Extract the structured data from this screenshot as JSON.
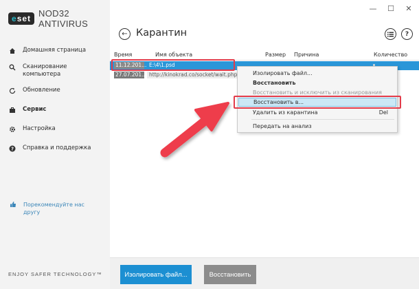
{
  "app": {
    "logo_text": "eset",
    "product_name": "NOD32 ANTIVIRUS",
    "tagline": "ENJOY SAFER TECHNOLOGY™",
    "controls": {
      "minimize": "—",
      "maximize": "☐",
      "close": "✕"
    }
  },
  "sidebar": {
    "items": [
      {
        "label": "Домашняя страница",
        "icon": "home-icon"
      },
      {
        "label": "Сканирование компьютера",
        "icon": "search-icon"
      },
      {
        "label": "Обновление",
        "icon": "refresh-icon"
      },
      {
        "label": "Сервис",
        "icon": "briefcase-icon",
        "active": true
      },
      {
        "label": "Настройка",
        "icon": "gear-icon"
      },
      {
        "label": "Справка и поддержка",
        "icon": "help-icon"
      }
    ],
    "recommend": "Порекомендуйте нас другу"
  },
  "header": {
    "title": "Карантин"
  },
  "table": {
    "columns": [
      "Время",
      "Имя объекта",
      "Размер",
      "Причина",
      "Количество"
    ],
    "rows": [
      {
        "date": "11.12.201...",
        "name": "E:\\4\\1.psd",
        "selected": true
      },
      {
        "date": "27.07.201...",
        "name": "http://kinokrad.co/socket/wait.php",
        "selected": false
      }
    ]
  },
  "context_menu": {
    "items": [
      {
        "label": "Изолировать файл...",
        "style": "normal"
      },
      {
        "label": "Восстановить",
        "style": "bold"
      },
      {
        "label": "Восстановить и исключить из сканирования",
        "style": "disabled"
      },
      {
        "label": "Восстановить в...",
        "style": "selected"
      },
      {
        "label": "Удалить из карантина",
        "style": "normal",
        "shortcut": "Del"
      },
      {
        "label": "Передать на анализ",
        "style": "normal"
      }
    ]
  },
  "buttons": {
    "isolate": "Изолировать файл...",
    "restore": "Восстановить"
  },
  "colors": {
    "accent": "#1c8fd2",
    "selection": "#2a96d8",
    "highlight": "#e23b4a"
  }
}
